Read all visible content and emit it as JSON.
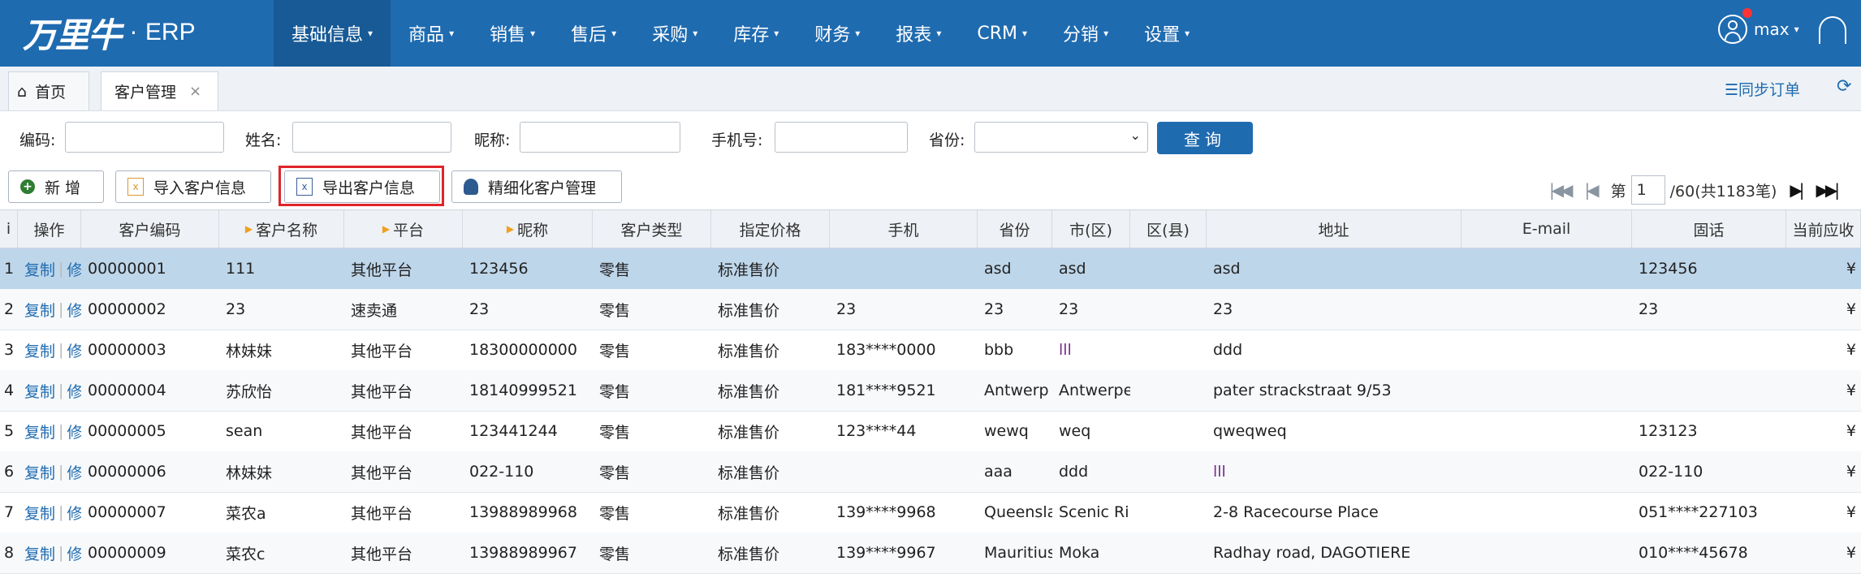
{
  "app": {
    "logo_text": "万里牛",
    "logo_dot": "·",
    "logo_suffix": "ERP"
  },
  "nav": [
    {
      "label": "基础信息",
      "active": true
    },
    {
      "label": "商品"
    },
    {
      "label": "销售"
    },
    {
      "label": "售后"
    },
    {
      "label": "采购"
    },
    {
      "label": "库存"
    },
    {
      "label": "财务"
    },
    {
      "label": "报表"
    },
    {
      "label": "CRM"
    },
    {
      "label": "分销"
    },
    {
      "label": "设置"
    }
  ],
  "user": {
    "name": "max"
  },
  "tabs": {
    "home": "首页",
    "customer": "客户管理",
    "close": "×"
  },
  "sync_label": "☰同步订单",
  "filters": {
    "code_label": "编码:",
    "name_label": "姓名:",
    "nick_label": "昵称:",
    "phone_label": "手机号:",
    "province_label": "省份:",
    "query_label": "查询"
  },
  "toolbar": {
    "add": "新 增",
    "import": "导入客户信息",
    "export": "导出客户信息",
    "fine": "精细化客户管理"
  },
  "pager": {
    "prefix": "第",
    "page": "1",
    "suffix": "/60(共1183笔)"
  },
  "columns": [
    "i",
    "操作",
    "客户编码",
    "客户名称",
    "平台",
    "昵称",
    "客户类型",
    "指定价格",
    "手机",
    "省份",
    "市(区)",
    "区(县)",
    "地址",
    "E-mail",
    "固话",
    "当前应收"
  ],
  "row_actions": {
    "copy": "复制",
    "edit": "修改"
  },
  "rows": [
    {
      "idx": "1",
      "code": "00000001",
      "name": "111",
      "platform": "其他平台",
      "nick": "123456",
      "type": "零售",
      "price": "标准售价",
      "mobile": "",
      "province": "asd",
      "city": "asd",
      "county": "",
      "address": "asd",
      "email": "",
      "tel": "123456",
      "recv": "¥"
    },
    {
      "idx": "2",
      "code": "00000002",
      "name": "23",
      "platform": "速卖通",
      "nick": "23",
      "type": "零售",
      "price": "标准售价",
      "mobile": "23",
      "province": "23",
      "city": "23",
      "county": "",
      "address": "23",
      "email": "",
      "tel": "23",
      "recv": "¥"
    },
    {
      "idx": "3",
      "code": "00000003",
      "name": "林妹妹",
      "platform": "其他平台",
      "nick": "18300000000",
      "type": "零售",
      "price": "标准售价",
      "mobile": "183****0000",
      "province": "bbb",
      "city": "lll",
      "county": "",
      "address": "ddd",
      "email": "",
      "tel": "",
      "recv": "¥"
    },
    {
      "idx": "4",
      "code": "00000004",
      "name": "苏欣怡",
      "platform": "其他平台",
      "nick": "18140999521",
      "type": "零售",
      "price": "标准售价",
      "mobile": "181****9521",
      "province": "Antwerp",
      "city": "Antwerpe",
      "county": "",
      "address": "pater strackstraat 9/53",
      "email": "",
      "tel": "",
      "recv": "¥"
    },
    {
      "idx": "5",
      "code": "00000005",
      "name": "sean",
      "platform": "其他平台",
      "nick": "123441244",
      "type": "零售",
      "price": "标准售价",
      "mobile": "123****44",
      "province": "wewq",
      "city": "weq",
      "county": "",
      "address": "qweqweq",
      "email": "",
      "tel": "123123",
      "recv": "¥"
    },
    {
      "idx": "6",
      "code": "00000006",
      "name": "林妹妹",
      "platform": "其他平台",
      "nick": "022-110",
      "type": "零售",
      "price": "标准售价",
      "mobile": "",
      "province": "aaa",
      "city": "ddd",
      "county": "",
      "address": "lll",
      "email": "",
      "tel": "022-110",
      "recv": "¥"
    },
    {
      "idx": "7",
      "code": "00000007",
      "name": "菜农a",
      "platform": "其他平台",
      "nick": "13988989968",
      "type": "零售",
      "price": "标准售价",
      "mobile": "139****9968",
      "province": "Queensla",
      "city": "Scenic Ri",
      "county": "",
      "address": "2-8 Racecourse Place",
      "email": "",
      "tel": "051****227103",
      "recv": "¥"
    },
    {
      "idx": "8",
      "code": "00000009",
      "name": "菜农c",
      "platform": "其他平台",
      "nick": "13988989967",
      "type": "零售",
      "price": "标准售价",
      "mobile": "139****9967",
      "province": "Mauritius",
      "city": "Moka",
      "county": "",
      "address": "Radhay road, DAGOTIERE",
      "email": "",
      "tel": "010****45678",
      "recv": "¥"
    }
  ]
}
